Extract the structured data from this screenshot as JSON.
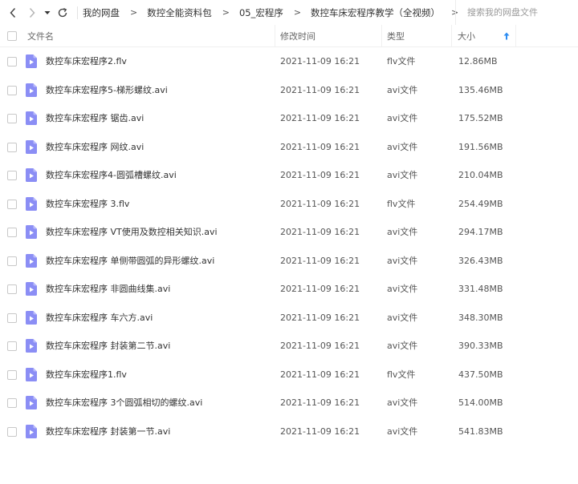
{
  "nav": {
    "back_icon": "chevron-left-icon",
    "forward_icon": "chevron-right-icon",
    "dropdown_icon": "caret-down-icon",
    "refresh_icon": "refresh-icon"
  },
  "breadcrumb": {
    "items": [
      "我的网盘",
      "数控全能资料包",
      "05_宏程序",
      "数控车床宏程序教学（全视频）"
    ],
    "separator": ">"
  },
  "search": {
    "placeholder": "搜索我的网盘文件"
  },
  "columns": {
    "name": "文件名",
    "date": "修改时间",
    "type": "类型",
    "size": "大小"
  },
  "sort": {
    "column": "size",
    "direction": "ascending",
    "icon": "arrow-up-icon",
    "color": "#2b8cf2"
  },
  "file_icon": {
    "name": "video-file-icon",
    "color": "#8b8ef5"
  },
  "files": [
    {
      "name": "数控车床宏程序2.flv",
      "date": "2021-11-09 16:21",
      "type": "flv文件",
      "size": "12.86MB"
    },
    {
      "name": "数控车床宏程序5-梯形螺纹.avi",
      "date": "2021-11-09 16:21",
      "type": "avi文件",
      "size": "135.46MB"
    },
    {
      "name": "数控车床宏程序 锯齿.avi",
      "date": "2021-11-09 16:21",
      "type": "avi文件",
      "size": "175.52MB"
    },
    {
      "name": "数控车床宏程序 网纹.avi",
      "date": "2021-11-09 16:21",
      "type": "avi文件",
      "size": "191.56MB"
    },
    {
      "name": "数控车床宏程序4-圆弧槽螺纹.avi",
      "date": "2021-11-09 16:21",
      "type": "avi文件",
      "size": "210.04MB"
    },
    {
      "name": "数控车床宏程序 3.flv",
      "date": "2021-11-09 16:21",
      "type": "flv文件",
      "size": "254.49MB"
    },
    {
      "name": "数控车床宏程序 VT使用及数控相关知识.avi",
      "date": "2021-11-09 16:21",
      "type": "avi文件",
      "size": "294.17MB"
    },
    {
      "name": "数控车床宏程序 单侧带圆弧的异形螺纹.avi",
      "date": "2021-11-09 16:21",
      "type": "avi文件",
      "size": "326.43MB"
    },
    {
      "name": "数控车床宏程序 非圆曲线集.avi",
      "date": "2021-11-09 16:21",
      "type": "avi文件",
      "size": "331.48MB"
    },
    {
      "name": "数控车床宏程序 车六方.avi",
      "date": "2021-11-09 16:21",
      "type": "avi文件",
      "size": "348.30MB"
    },
    {
      "name": "数控车床宏程序 封装第二节.avi",
      "date": "2021-11-09 16:21",
      "type": "avi文件",
      "size": "390.33MB"
    },
    {
      "name": "数控车床宏程序1.flv",
      "date": "2021-11-09 16:21",
      "type": "flv文件",
      "size": "437.50MB"
    },
    {
      "name": "数控车床宏程序 3个圆弧相切的螺纹.avi",
      "date": "2021-11-09 16:21",
      "type": "avi文件",
      "size": "514.00MB"
    },
    {
      "name": "数控车床宏程序 封装第一节.avi",
      "date": "2021-11-09 16:21",
      "type": "avi文件",
      "size": "541.83MB"
    }
  ]
}
